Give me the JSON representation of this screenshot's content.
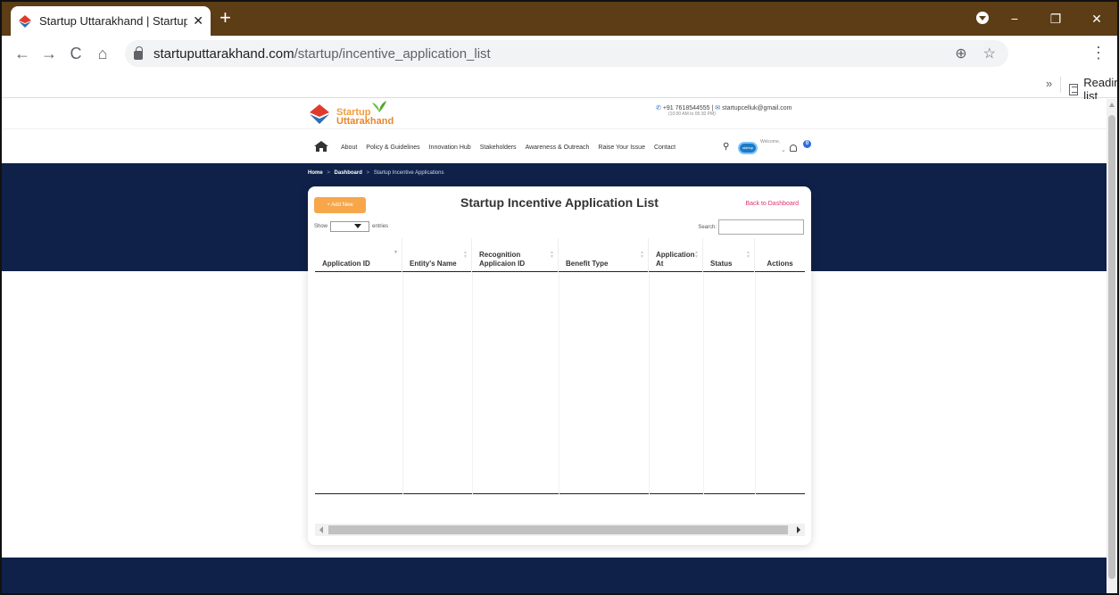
{
  "browser": {
    "tab_title": "Startup Uttarakhand | Startup Re",
    "tab_close": "✕",
    "new_tab": "+",
    "url_host": "startuputtarakhand.com",
    "url_path": "/startup/incentive_application_list",
    "reading_list": "Reading list",
    "bookmarks_more": "»",
    "controls": {
      "minimize": "−",
      "restore": "❐",
      "close": "✕"
    },
    "nav": {
      "back": "←",
      "forward": "→",
      "reload": "C",
      "home": "⌂"
    },
    "menu": "⋮"
  },
  "site": {
    "logo_line1": "Startup",
    "logo_line2": "Uttarakhand",
    "phone": "+91 7618544555",
    "email": "startupcelluk@gmail.com",
    "hours": "(10:00 AM to 05:30 PM)",
    "nav_items": [
      "About",
      "Policy & Guidelines",
      "Innovation Hub",
      "Stakeholders",
      "Awareness & Outreach",
      "Raise Your Issue",
      "Contact"
    ],
    "welcome": "Welcome,",
    "bell_count": "0",
    "avatar_text": "startup"
  },
  "breadcrumb": {
    "home": "Home",
    "dashboard": "Dashboard",
    "current": "Startup Incentive Applications",
    "separator": ">"
  },
  "card": {
    "add_new": "+  Add New",
    "title": "Startup Incentive Application List",
    "back_link": "Back to Dashboard",
    "show_label": "Show",
    "entries_label": "entries",
    "search_label": "Search:",
    "search_value": ""
  },
  "table": {
    "columns": [
      "Application ID",
      "Entity's Name",
      "Recognition Applicaion ID",
      "Benefit Type",
      "Application At",
      "Status",
      "Actions"
    ],
    "rows": []
  },
  "colors": {
    "titlebar": "#5c3d16",
    "navy": "#0f2149",
    "accent_orange": "#f7a64a",
    "link_pink": "#e0336b"
  }
}
